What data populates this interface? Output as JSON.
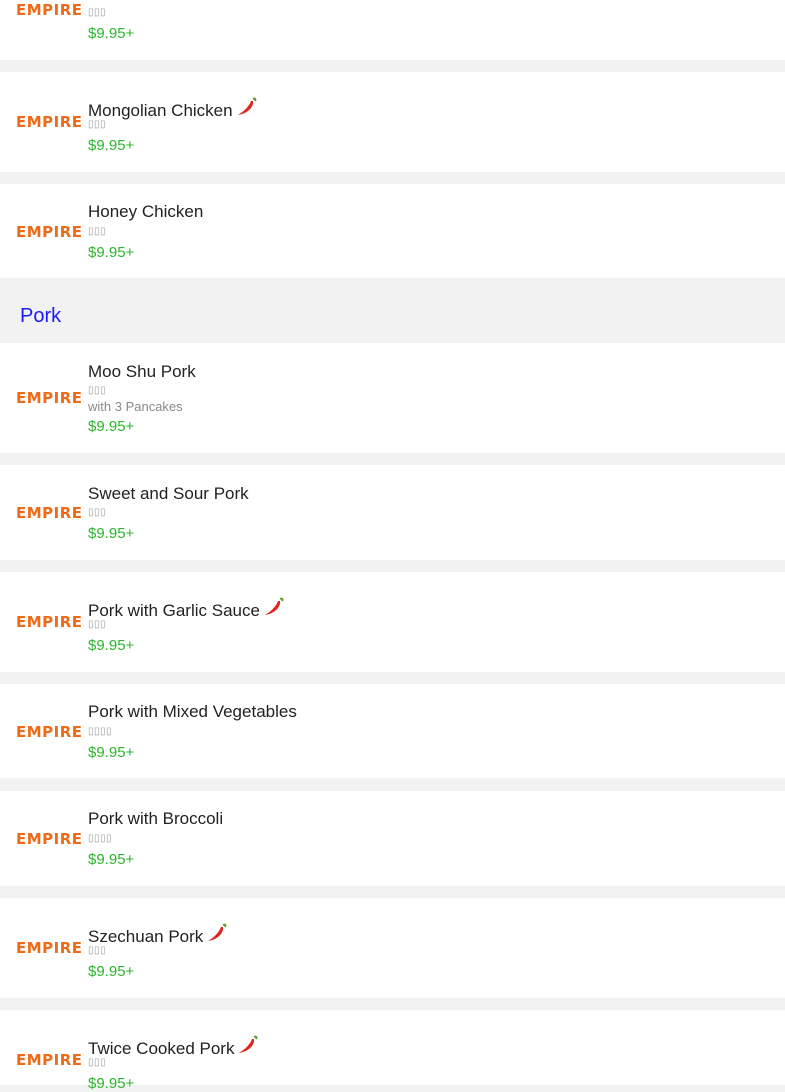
{
  "brand": {
    "logo_text": "EMPIRE",
    "accent": "#ef6a16",
    "price_color": "#2db52d",
    "section_color": "#1a1aff"
  },
  "chicken_items": [
    {
      "name": "",
      "cn": "▯▯▯",
      "price": "$9.95+"
    },
    {
      "name": "Mongolian Chicken",
      "cn": "▯▯▯",
      "price": "$9.95+",
      "spicy": true
    },
    {
      "name": "Honey Chicken",
      "cn": "▯▯▯",
      "price": "$9.95+"
    }
  ],
  "pork_section": {
    "title": "Pork",
    "items": [
      {
        "name": "Moo Shu Pork",
        "cn": "▯▯▯",
        "description": "with 3 Pancakes",
        "price": "$9.95+"
      },
      {
        "name": "Sweet and Sour Pork",
        "cn": "▯▯▯",
        "price": "$9.95+"
      },
      {
        "name": "Pork with Garlic Sauce",
        "cn": "▯▯▯",
        "price": "$9.95+",
        "spicy": true
      },
      {
        "name": "Pork with Mixed Vegetables",
        "cn": "▯▯▯▯",
        "price": "$9.95+"
      },
      {
        "name": "Pork with Broccoli",
        "cn": "▯▯▯▯",
        "price": "$9.95+"
      },
      {
        "name": "Szechuan Pork",
        "cn": "▯▯▯",
        "price": "$9.95+",
        "spicy": true
      },
      {
        "name": "Twice Cooked Pork",
        "cn": "▯▯▯",
        "price": "$9.95+",
        "spicy": true
      }
    ]
  },
  "icons": {
    "spicy": "chili-pepper-icon"
  }
}
